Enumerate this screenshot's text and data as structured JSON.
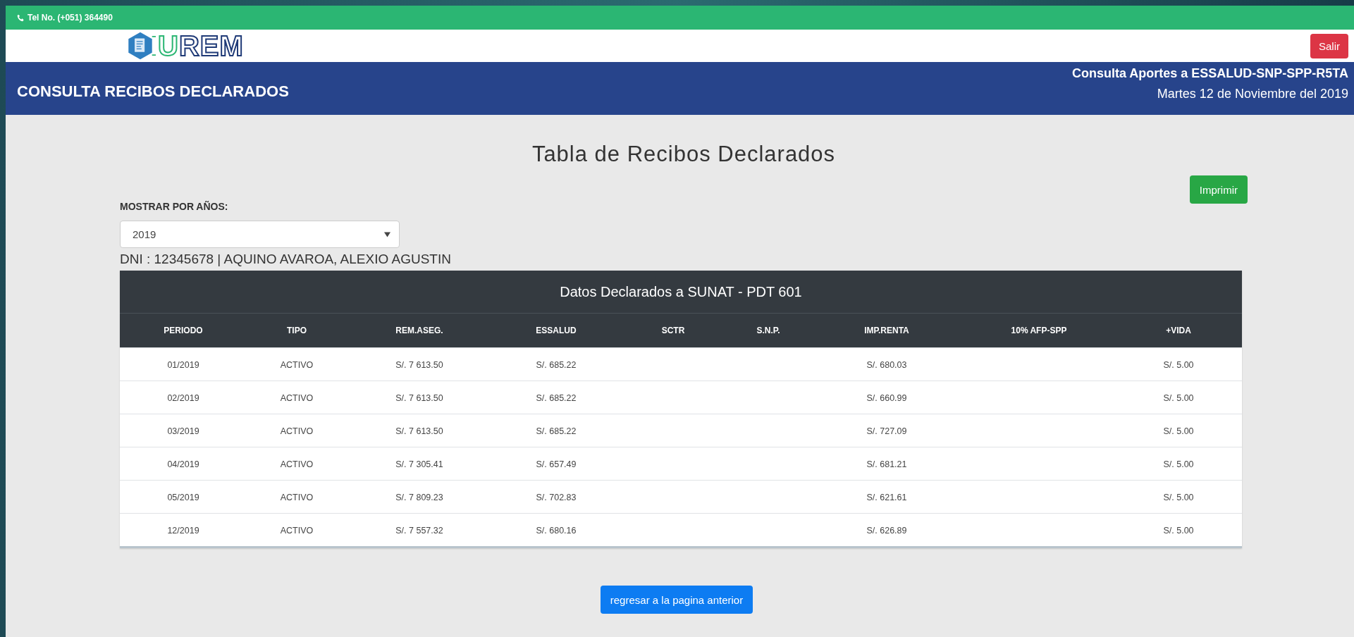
{
  "top_bar": {
    "phone": "Tel No. (+051) 364490"
  },
  "header": {
    "logo": "UREM",
    "logout_button": "Salir"
  },
  "banner": {
    "title": "CONSULTA RECIBOS DECLARADOS",
    "subtitle": "Consulta Aportes a ESSALUD-SNP-SPP-R5TA",
    "date": "Martes 12 de Noviembre del 2019"
  },
  "page_title": "Tabla de Recibos Declarados",
  "print_button": "Imprimir",
  "year_filter": {
    "label": "MOSTRAR POR AÑOS:",
    "value": "2019"
  },
  "person": "DNI : 12345678 | AQUINO AVAROA, ALEXIO AGUSTIN",
  "table": {
    "caption": "Datos Declarados a SUNAT - PDT 601",
    "columns": [
      "PERIODO",
      "TIPO",
      "REM.ASEG.",
      "ESSALUD",
      "SCTR",
      "S.N.P.",
      "IMP.RENTA",
      "10% AFP-SPP",
      "+VIDA"
    ],
    "rows": [
      [
        "01/2019",
        "ACTIVO",
        "S/. 7 613.50",
        "S/. 685.22",
        null,
        null,
        "S/. 680.03",
        null,
        "S/. 5.00"
      ],
      [
        "02/2019",
        "ACTIVO",
        "S/. 7 613.50",
        "S/. 685.22",
        null,
        null,
        "S/. 660.99",
        null,
        "S/. 5.00"
      ],
      [
        "03/2019",
        "ACTIVO",
        "S/. 7 613.50",
        "S/. 685.22",
        null,
        null,
        "S/. 727.09",
        null,
        "S/. 5.00"
      ],
      [
        "04/2019",
        "ACTIVO",
        "S/. 7 305.41",
        "S/. 657.49",
        null,
        null,
        "S/. 681.21",
        null,
        "S/. 5.00"
      ],
      [
        "05/2019",
        "ACTIVO",
        "S/. 7 809.23",
        "S/. 702.83",
        null,
        null,
        "S/. 621.61",
        null,
        "S/. 5.00"
      ],
      [
        "12/2019",
        "ACTIVO",
        "S/. 7 557.32",
        "S/. 680.16",
        null,
        null,
        "S/. 626.89",
        null,
        "S/. 5.00"
      ]
    ]
  },
  "back_button": "regresar a la pagina anterior"
}
